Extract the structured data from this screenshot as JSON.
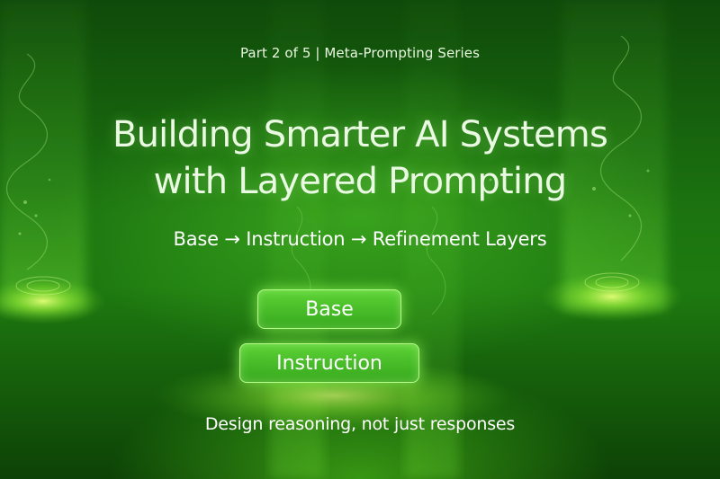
{
  "series_label": "Part 2 of 5 | Meta-Prompting Series",
  "headline": {
    "line1": "Building Smarter AI Systems",
    "line2": "with Layered Prompting"
  },
  "subheadline": "Base → Instruction → Refinement Layers",
  "layers": [
    {
      "label": "Base"
    },
    {
      "label": "Instruction"
    }
  ],
  "tagline": "Design reasoning, not just responses",
  "colors": {
    "background_dark": "#0d4206",
    "background_mid": "#1e7a10",
    "accent_glow": "#b8ff8c",
    "button_fill": "#4fc42c"
  }
}
